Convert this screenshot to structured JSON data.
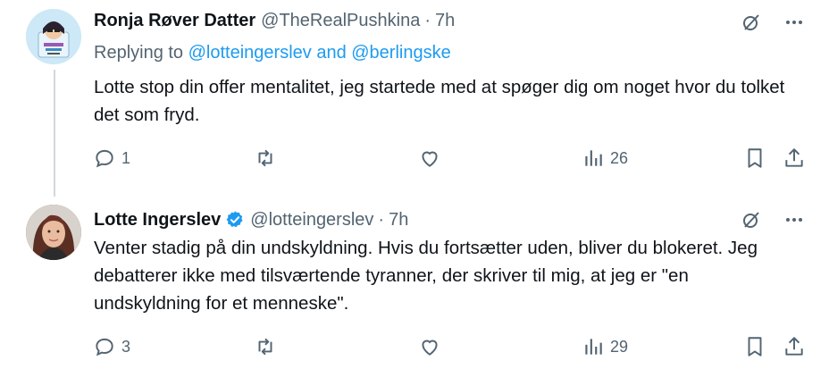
{
  "tweets": [
    {
      "author_name": "Ronja Røver Datter",
      "handle": "@TheRealPushkina",
      "separator": "·",
      "time": "7h",
      "replying_prefix": "Replying to ",
      "replying_mentions": "@lotteingerslev and @berlingske",
      "text": "Lotte stop din offer mentalitet, jeg startede med at spøger dig om noget hvor du tolket det som fryd.",
      "reply_count": "1",
      "retweet_count": "",
      "like_count": "",
      "view_count": "26",
      "verified": false
    },
    {
      "author_name": "Lotte Ingerslev",
      "handle": "@lotteingerslev",
      "separator": "·",
      "time": "7h",
      "text": "Venter stadig på din undskyldning. Hvis du fortsætter uden, bliver du blokeret. Jeg debatterer ikke med tilsværtende tyranner, der skriver til mig, at jeg er \"en undskyldning for et menneske\".",
      "reply_count": "3",
      "retweet_count": "",
      "like_count": "",
      "view_count": "29",
      "verified": true
    }
  ],
  "colors": {
    "text": "#0f1419",
    "secondary": "#536471",
    "accent": "#1d9bf0",
    "thread_line": "#cfd9de"
  },
  "icons": [
    "reply-icon",
    "retweet-icon",
    "like-icon",
    "views-icon",
    "bookmark-icon",
    "share-icon",
    "grok-icon",
    "more-icon",
    "verified-badge-icon"
  ]
}
